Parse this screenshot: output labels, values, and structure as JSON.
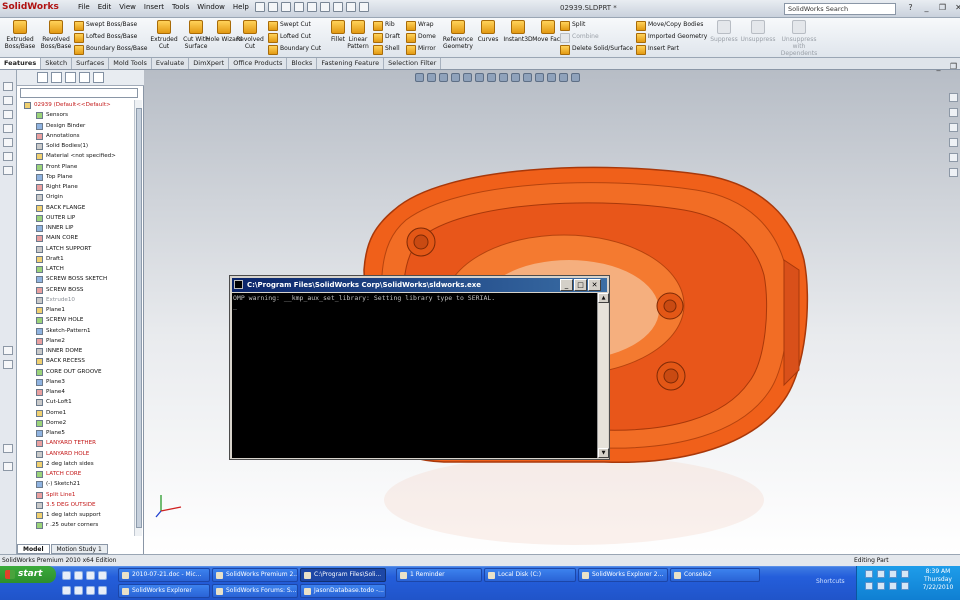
{
  "app": {
    "logo": "SolidWorks",
    "menu": [
      "File",
      "Edit",
      "View",
      "Insert",
      "Tools",
      "Window",
      "Help"
    ],
    "document_title": "02939.SLDPRT *",
    "search_placeholder": "SolidWorks Search"
  },
  "command_manager": {
    "big_buttons": [
      {
        "label": "Extruded Boss/Base",
        "enabled": true
      },
      {
        "label": "Revolved Boss/Base",
        "enabled": true
      },
      {
        "label": "Extruded Cut",
        "enabled": true
      },
      {
        "label": "Cut With Surface",
        "enabled": true
      },
      {
        "label": "Hole Wizard",
        "enabled": true
      },
      {
        "label": "Revolved Cut",
        "enabled": true
      },
      {
        "label": "Fillet",
        "enabled": true
      },
      {
        "label": "Linear Pattern",
        "enabled": true
      },
      {
        "label": "Reference Geometry",
        "enabled": true
      },
      {
        "label": "Curves",
        "enabled": true
      },
      {
        "label": "Instant3D",
        "enabled": true
      },
      {
        "label": "Move Face",
        "enabled": true
      },
      {
        "label": "Suppress",
        "enabled": false
      },
      {
        "label": "Unsuppress",
        "enabled": false
      },
      {
        "label": "Unsuppress with Dependents",
        "enabled": false
      }
    ],
    "small_buttons": [
      {
        "label": "Swept Boss/Base",
        "enabled": true
      },
      {
        "label": "Lofted Boss/Base",
        "enabled": true
      },
      {
        "label": "Boundary Boss/Base",
        "enabled": true
      },
      {
        "label": "Swept Cut",
        "enabled": true
      },
      {
        "label": "Lofted Cut",
        "enabled": true
      },
      {
        "label": "Boundary Cut",
        "enabled": true
      },
      {
        "label": "Rib",
        "enabled": true
      },
      {
        "label": "Draft",
        "enabled": true
      },
      {
        "label": "Shell",
        "enabled": true
      },
      {
        "label": "Wrap",
        "enabled": true
      },
      {
        "label": "Dome",
        "enabled": true
      },
      {
        "label": "Mirror",
        "enabled": true
      },
      {
        "label": "Split",
        "enabled": true
      },
      {
        "label": "Combine",
        "enabled": false
      },
      {
        "label": "Delete Solid/Surface",
        "enabled": true
      },
      {
        "label": "Move/Copy Bodies",
        "enabled": true
      },
      {
        "label": "Imported Geometry",
        "enabled": true
      },
      {
        "label": "Insert Part",
        "enabled": true
      }
    ]
  },
  "tabs": [
    "Features",
    "Sketch",
    "Surfaces",
    "Mold Tools",
    "Evaluate",
    "DimXpert",
    "Office Products",
    "Blocks",
    "Fastening Feature",
    "Selection Filter"
  ],
  "feature_tree": [
    {
      "label": "02939 (Default<<Default>",
      "style": "red",
      "indent": 0
    },
    {
      "label": "Sensors",
      "style": "",
      "indent": 1
    },
    {
      "label": "Design Binder",
      "style": "",
      "indent": 1
    },
    {
      "label": "Annotations",
      "style": "",
      "indent": 1
    },
    {
      "label": "Solid Bodies(1)",
      "style": "",
      "indent": 1
    },
    {
      "label": "Material <not specified>",
      "style": "",
      "indent": 1
    },
    {
      "label": "Front Plane",
      "style": "",
      "indent": 1
    },
    {
      "label": "Top Plane",
      "style": "",
      "indent": 1
    },
    {
      "label": "Right Plane",
      "style": "",
      "indent": 1
    },
    {
      "label": "Origin",
      "style": "",
      "indent": 1
    },
    {
      "label": "BACK FLANGE",
      "style": "",
      "indent": 1
    },
    {
      "label": "OUTER LIP",
      "style": "",
      "indent": 1
    },
    {
      "label": "INNER LIP",
      "style": "",
      "indent": 1
    },
    {
      "label": "MAIN CORE",
      "style": "",
      "indent": 1
    },
    {
      "label": "LATCH SUPPORT",
      "style": "",
      "indent": 1
    },
    {
      "label": "Draft1",
      "style": "",
      "indent": 1
    },
    {
      "label": "LATCH",
      "style": "",
      "indent": 1
    },
    {
      "label": "SCREW BOSS SKETCH",
      "style": "",
      "indent": 1
    },
    {
      "label": "SCREW BOSS",
      "style": "",
      "indent": 1
    },
    {
      "label": "Extrude10",
      "style": "gray",
      "indent": 1
    },
    {
      "label": "Plane1",
      "style": "",
      "indent": 1
    },
    {
      "label": "SCREW HOLE",
      "style": "",
      "indent": 1
    },
    {
      "label": "Sketch-Pattern1",
      "style": "",
      "indent": 1
    },
    {
      "label": "Plane2",
      "style": "",
      "indent": 1
    },
    {
      "label": "INNER DOME",
      "style": "",
      "indent": 1
    },
    {
      "label": "BACK RECESS",
      "style": "",
      "indent": 1
    },
    {
      "label": "CORE OUT GROOVE",
      "style": "",
      "indent": 1
    },
    {
      "label": "Plane3",
      "style": "",
      "indent": 1
    },
    {
      "label": "Plane4",
      "style": "",
      "indent": 1
    },
    {
      "label": "Cut-Loft1",
      "style": "",
      "indent": 1
    },
    {
      "label": "Dome1",
      "style": "",
      "indent": 1
    },
    {
      "label": "Dome2",
      "style": "",
      "indent": 1
    },
    {
      "label": "Plane5",
      "style": "",
      "indent": 1
    },
    {
      "label": "LANYARD TETHER",
      "style": "red",
      "indent": 1
    },
    {
      "label": "LANYARD HOLE",
      "style": "red",
      "indent": 1
    },
    {
      "label": "2 deg latch sides",
      "style": "",
      "indent": 1
    },
    {
      "label": "LATCH CORE",
      "style": "red",
      "indent": 1
    },
    {
      "label": "(-) Sketch21",
      "style": "",
      "indent": 1
    },
    {
      "label": "Split Line1",
      "style": "red",
      "indent": 1
    },
    {
      "label": "3.5 DEG OUTSIDE",
      "style": "red",
      "indent": 1
    },
    {
      "label": "1 deg latch support",
      "style": "",
      "indent": 1
    },
    {
      "label": "r .25 outer corners",
      "style": "",
      "indent": 1
    }
  ],
  "bottom_tabs": [
    "Model",
    "Motion Study 1"
  ],
  "console": {
    "title": "C:\\Program Files\\SolidWorks Corp\\SolidWorks\\sldworks.exe",
    "text": "OMP warning: __kmp_aux_set_library: Setting library type to SERIAL.\n_"
  },
  "status": {
    "left": "SolidWorks Premium 2010 x64 Edition",
    "mode": "Editing Part"
  },
  "taskbar": {
    "start_label": "start",
    "row1": [
      "2010-07-21.doc - Mic...",
      "SolidWorks Premium 2...",
      "C:\\Program Files\\Soli...",
      "1 Reminder",
      "Local Disk (C:)",
      "SolidWorks Explorer 2...",
      "Console2"
    ],
    "row2": [
      "SolidWorks Explorer",
      "SolidWorks Forums: S...",
      "JasonDatabase.todo -..."
    ],
    "active_index": 2,
    "shortcuts_label": "Shortcuts",
    "time": "8:39 AM",
    "day": "Thursday",
    "date": "7/22/2010"
  },
  "colors": {
    "part_orange": "#f0601a",
    "console_bg": "#000000",
    "title_blue": "#0a246a"
  }
}
